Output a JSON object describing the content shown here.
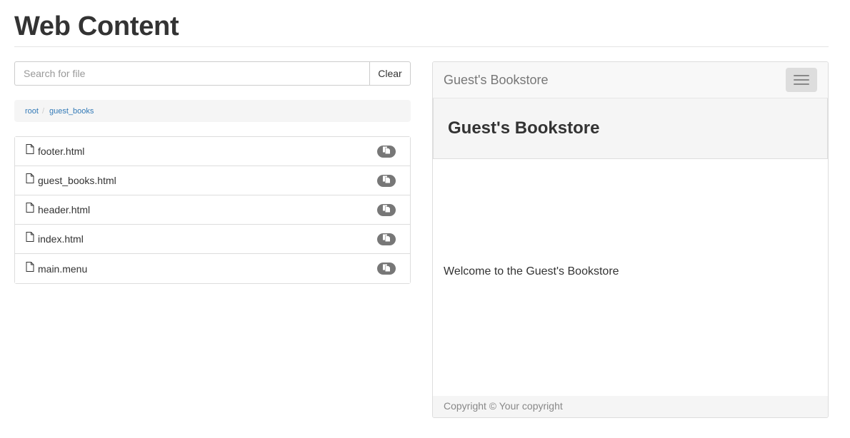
{
  "page": {
    "title": "Web Content"
  },
  "search": {
    "placeholder": "Search for file",
    "value": "",
    "clear_label": "Clear"
  },
  "breadcrumb": {
    "items": [
      {
        "label": "root"
      },
      {
        "label": "guest_books"
      }
    ],
    "separator": "/"
  },
  "files": [
    {
      "name": "footer.html"
    },
    {
      "name": "guest_books.html"
    },
    {
      "name": "header.html"
    },
    {
      "name": "index.html"
    },
    {
      "name": "main.menu"
    }
  ],
  "preview": {
    "brand": "Guest's Bookstore",
    "jumbotron_title": "Guest's Bookstore",
    "welcome": "Welcome to the Guest's Bookstore",
    "footer": "Copyright © Your copyright"
  },
  "icons": {
    "file": "file-icon",
    "copy": "copy-icon",
    "menu": "hamburger-icon"
  },
  "colors": {
    "link": "#337ab7",
    "badge": "#777777",
    "panel_bg": "#f5f5f5"
  }
}
